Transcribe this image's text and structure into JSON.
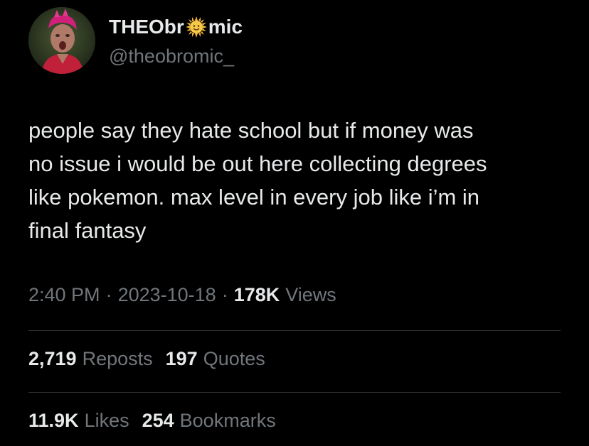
{
  "author": {
    "name_part1": "THEObr",
    "name_emoji": "sun-emoji",
    "name_part2": "mic",
    "handle": "@theobromic_",
    "avatar_icon": "profile-avatar"
  },
  "tweet": {
    "lines": [
      "people say they hate school but if money was",
      "no issue i would be out here collecting degrees",
      "like pokemon. max level in every job like i’m in",
      "final fantasy"
    ]
  },
  "meta": {
    "time": "2:40 PM",
    "separator": "·",
    "date": "2023-10-18",
    "views_count": "178K",
    "views_label": "Views"
  },
  "stats": {
    "reposts_count": "2,719",
    "reposts_label": "Reposts",
    "quotes_count": "197",
    "quotes_label": "Quotes",
    "likes_count": "11.9K",
    "likes_label": "Likes",
    "bookmarks_count": "254",
    "bookmarks_label": "Bookmarks"
  },
  "colors": {
    "background": "#000000",
    "primary_text": "#e7e9ea",
    "secondary_text": "#71767b",
    "divider": "#2f3336"
  }
}
